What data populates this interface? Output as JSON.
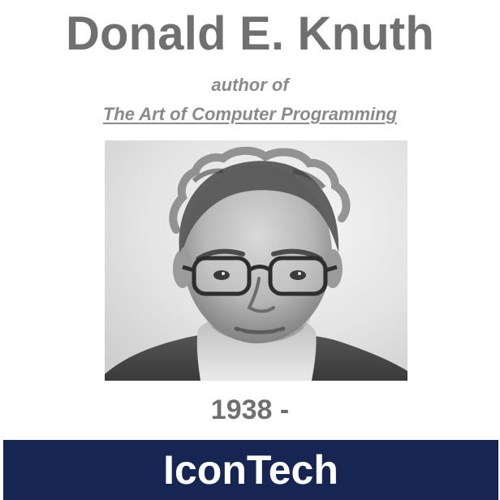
{
  "header": {
    "name": "Donald E. Knuth",
    "subtitle": "author of",
    "book_title": "The Art of Computer Programming"
  },
  "photo": {
    "subject": "portrait"
  },
  "lifespan": {
    "text": "1938 -"
  },
  "footer": {
    "brand": "IconTech"
  },
  "colors": {
    "title_gray": "#707070",
    "subtitle_gray": "#8a8a8a",
    "footer_navy": "#172553",
    "footer_text": "#ffffff",
    "background": "#ffffff"
  }
}
